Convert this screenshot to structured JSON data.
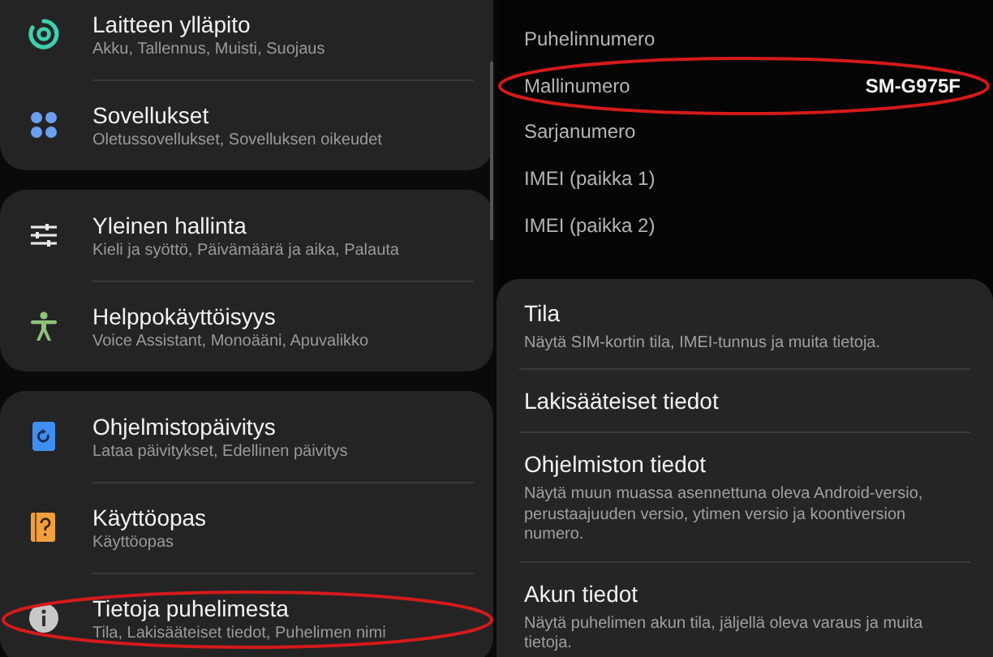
{
  "settings_menu": {
    "cards": [
      {
        "items": [
          {
            "kind": "care",
            "title": "Laitteen ylläpito",
            "subtitle": "Akku, Tallennus, Muisti, Suojaus",
            "highlighted": false
          },
          {
            "kind": "apps",
            "title": "Sovellukset",
            "subtitle": "Oletussovellukset, Sovelluksen oikeudet",
            "highlighted": false
          }
        ]
      },
      {
        "items": [
          {
            "kind": "sliders",
            "title": "Yleinen hallinta",
            "subtitle": "Kieli ja syöttö, Päivämäärä ja aika, Palauta",
            "highlighted": false
          },
          {
            "kind": "accessibility",
            "title": "Helppokäyttöisyys",
            "subtitle": "Voice Assistant, Monoääni, Apuvalikko",
            "highlighted": false
          }
        ]
      },
      {
        "items": [
          {
            "kind": "update",
            "title": "Ohjelmistopäivitys",
            "subtitle": "Lataa päivitykset, Edellinen päivitys",
            "highlighted": false
          },
          {
            "kind": "manual",
            "title": "Käyttöopas",
            "subtitle": "Käyttöopas",
            "highlighted": false
          },
          {
            "kind": "info",
            "title": "Tietoja puhelimesta",
            "subtitle": "Tila, Lakisääteiset tiedot, Puhelimen nimi",
            "highlighted": true
          }
        ]
      }
    ]
  },
  "phone_info": {
    "fields": [
      {
        "label": "Puhelinnumero",
        "highlighted": false
      },
      {
        "label": "Mallinumero",
        "value": "SM-G975F",
        "highlighted": true
      },
      {
        "label": "Sarjanumero",
        "highlighted": false
      },
      {
        "label": "IMEI (paikka 1)",
        "highlighted": false
      },
      {
        "label": "IMEI (paikka 2)",
        "highlighted": false
      }
    ],
    "items": [
      {
        "title": "Tila",
        "subtitle": "Näytä SIM-kortin tila, IMEI-tunnus ja muita tietoja."
      },
      {
        "title": "Lakisääteiset tiedot"
      },
      {
        "title": "Ohjelmiston tiedot",
        "subtitle": "Näytä muun muassa asennettuna oleva Android-versio, perustaajuuden versio, ytimen versio ja koontiversion numero."
      },
      {
        "title": "Akun tiedot",
        "subtitle": "Näytä puhelimen akun tila, jäljellä oleva varaus ja muita tietoja."
      }
    ]
  }
}
